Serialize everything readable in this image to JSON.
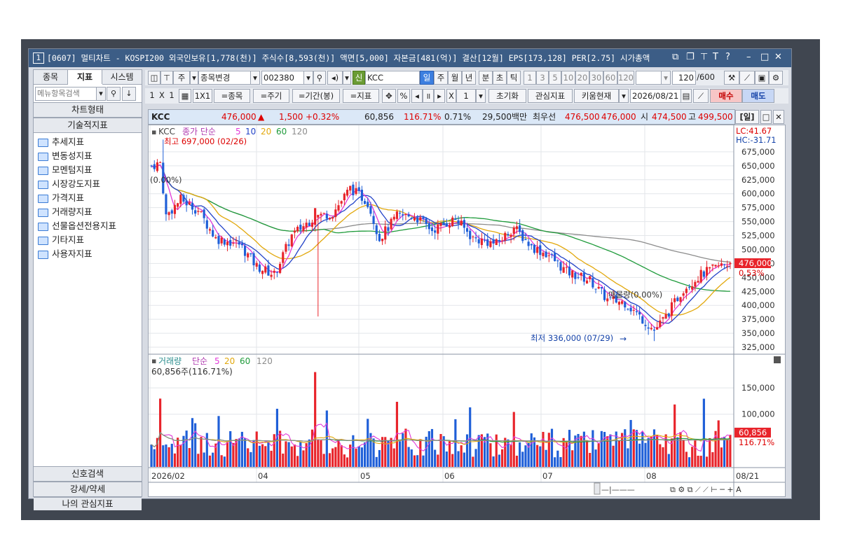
{
  "titlebar": {
    "number": "1",
    "text": "[0607] 멀티차트 - KOSPI200 외국인보유[1,778(천)] 주식수[8,593(천)] 액면[5,000] 자본금[481(억)] 결산[12월] EPS[173,128] PER[2.75] 시가총액"
  },
  "left_panel": {
    "tabs": [
      "종목",
      "지표",
      "시스템"
    ],
    "search_placeholder": "메뉴항목검색",
    "section_chart": "차트형태",
    "section_tech": "기술적지표",
    "tree": [
      "추세지표",
      "변동성지표",
      "모멘텀지표",
      "시장강도지표",
      "가격지표",
      "거래량지표",
      "선물옵션전용지표",
      "기타지표",
      "사용자지표"
    ],
    "bottom": [
      "신호검색",
      "강세/약세",
      "나의 관심지표"
    ]
  },
  "toolbar1": {
    "stock_label": "주",
    "change_label": "종목변경",
    "code": "002380",
    "credit": "신",
    "name": "KCC",
    "periods": [
      "일",
      "주",
      "월",
      "년",
      "분",
      "초",
      "틱"
    ],
    "nums": [
      "1",
      "3",
      "5",
      "10",
      "20",
      "30",
      "60",
      "120"
    ],
    "count": "120",
    "total": "/600"
  },
  "toolbar2": {
    "one": "1",
    "x": "X",
    "one2": "1",
    "onex1": "1X1",
    "item_btn": "=종목",
    "cycle_btn": "=주기",
    "period_btn": "=기간(봉)",
    "indicator_btn": "=지표",
    "percent": "%",
    "x1": "X",
    "x1n": "1",
    "init": "초기화",
    "watch": "관심지표",
    "kiwoom": "키움현재",
    "date": "2026/08/21",
    "buy": "매수",
    "sell": "매도"
  },
  "infobar": {
    "name": "KCC",
    "price": "476,000",
    "arrow": "▲",
    "change": "1,500",
    "pct": "+0.32%",
    "volume": "60,856",
    "vol_ratio": "116.71%",
    "turnover": "0.71%",
    "amount": "29,500백만",
    "best": "최우선",
    "ask": "476,500",
    "bid": "476,000",
    "open_lbl": "시",
    "open": "474,500",
    "high_lbl": "고",
    "high": "499,500",
    "day": "[일]"
  },
  "price_panel": {
    "legend": {
      "name": "KCC",
      "ma_title": "종가 단순",
      "p5": "5",
      "p10": "10",
      "p20": "20",
      "p60": "60",
      "p120": "120"
    },
    "lc": "LC:41.67",
    "hc": "HC:-31.71",
    "high_note": "최고 697,000 (02/26)",
    "low_note": "최저 336,000 (07/29)",
    "pct_left": "(0.00%)",
    "vol_note": "매물량(0.00%)",
    "last_tag": "476,000",
    "last_pct": "0.53%"
  },
  "volume_panel": {
    "legend_title": "거래량",
    "ma_title": "단순",
    "p5": "5",
    "p20": "20",
    "p60": "60",
    "p120": "120",
    "value": "60,856주(116.71%)",
    "tag": "60,856",
    "tag_pct": "116.71%"
  },
  "chart_data": [
    {
      "type": "candlestick",
      "title": "KCC",
      "ylim": [
        315000,
        700000
      ],
      "yticks": [
        675000,
        650000,
        625000,
        600000,
        575000,
        550000,
        525000,
        500000,
        475000,
        450000,
        425000,
        400000,
        375000,
        350000,
        325000
      ],
      "x_labels": [
        "2026/02",
        "04",
        "05",
        "06",
        "07",
        "08",
        "08/21"
      ],
      "ma_periods": [
        5,
        10,
        20,
        60,
        120
      ],
      "high": 697000,
      "high_date": "02/26",
      "low": 336000,
      "low_date": "07/29",
      "last": 476000
    },
    {
      "type": "bar",
      "title": "거래량",
      "yticks": [
        150000,
        100000
      ],
      "last": 60856
    }
  ],
  "colors": {
    "up": "#e8242b",
    "down": "#1f5fd8",
    "ma5": "#e23ad8",
    "ma10": "#2343c8",
    "ma20": "#e2a80c",
    "ma60": "#1f9b3b",
    "ma120": "#8c8c8c",
    "titlebar": "#3c5d86"
  }
}
